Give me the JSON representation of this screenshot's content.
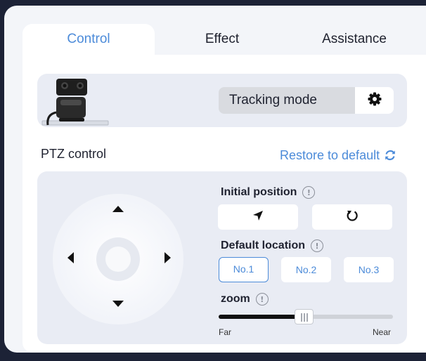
{
  "tabs": [
    {
      "label": "Control",
      "active": true
    },
    {
      "label": "Effect",
      "active": false
    },
    {
      "label": "Assistance",
      "active": false
    }
  ],
  "camera": {
    "tracking_mode_label": "Tracking mode",
    "settings_icon": "gear-icon"
  },
  "ptz": {
    "title": "PTZ control",
    "restore_label": "Restore to default",
    "restore_icon": "refresh-icon",
    "initial_position_label": "Initial position",
    "initial_position_buttons": [
      "navigate-icon",
      "reset-icon"
    ],
    "default_location_label": "Default location",
    "locations": [
      "No.1",
      "No.2",
      "No.3"
    ],
    "selected_location": "No.1",
    "zoom_label": "zoom",
    "zoom_min_label": "Far",
    "zoom_max_label": "Near",
    "zoom_value": 0.49
  },
  "colors": {
    "accent": "#4c8bd9",
    "background": "#1c2236",
    "card": "#e9ecf4"
  }
}
